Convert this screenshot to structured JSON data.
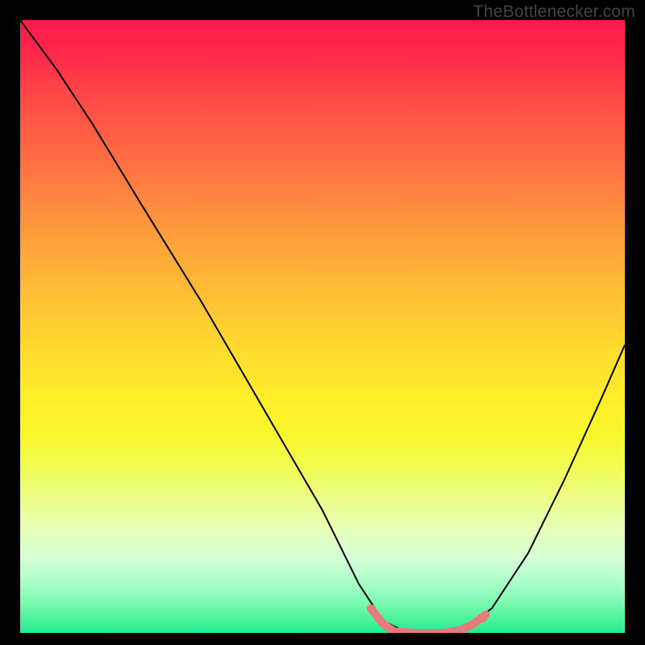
{
  "watermark": "TheBottlenecker.com",
  "chart_data": {
    "type": "line",
    "title": "",
    "xlabel": "",
    "ylabel": "",
    "xlim": [
      0,
      100
    ],
    "ylim": [
      0,
      100
    ],
    "background_gradient": {
      "top": "#ff1a4d",
      "mid": "#ffe82a",
      "bottom": "#22ec8e"
    },
    "series": [
      {
        "name": "bottleneck-curve",
        "color": "#000000",
        "points": [
          {
            "x": 0,
            "y": 100
          },
          {
            "x": 6,
            "y": 92
          },
          {
            "x": 12,
            "y": 83
          },
          {
            "x": 20,
            "y": 70
          },
          {
            "x": 30,
            "y": 54
          },
          {
            "x": 40,
            "y": 37
          },
          {
            "x": 50,
            "y": 20
          },
          {
            "x": 56,
            "y": 8
          },
          {
            "x": 60,
            "y": 2
          },
          {
            "x": 64,
            "y": 0
          },
          {
            "x": 70,
            "y": 0
          },
          {
            "x": 74,
            "y": 1
          },
          {
            "x": 78,
            "y": 4
          },
          {
            "x": 84,
            "y": 13
          },
          {
            "x": 90,
            "y": 25
          },
          {
            "x": 96,
            "y": 38
          },
          {
            "x": 100,
            "y": 47
          }
        ]
      },
      {
        "name": "highlight-segment",
        "color": "#e77a7a",
        "stroke_width": 8,
        "points": [
          {
            "x": 58,
            "y": 4
          },
          {
            "x": 60,
            "y": 1.5
          },
          {
            "x": 62,
            "y": 0.2
          },
          {
            "x": 66,
            "y": 0
          },
          {
            "x": 70,
            "y": 0
          },
          {
            "x": 73,
            "y": 0.5
          },
          {
            "x": 75,
            "y": 1.5
          },
          {
            "x": 77,
            "y": 3
          }
        ]
      }
    ],
    "markers": [
      {
        "x": 58,
        "y": 4,
        "r": 5,
        "color": "#e77a7a"
      },
      {
        "x": 76.5,
        "y": 2.5,
        "r": 6,
        "color": "#e77a7a"
      }
    ]
  }
}
